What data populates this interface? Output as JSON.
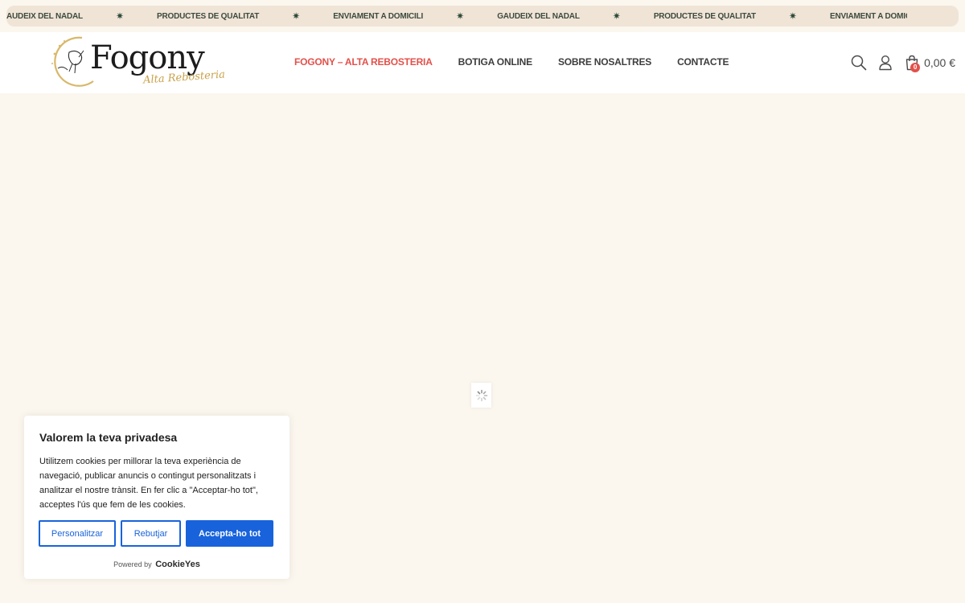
{
  "announcement": {
    "items": [
      "AUDEIX DEL NADAL",
      "PRODUCTES DE QUALITAT",
      "ENVIAMENT A DOMICILI",
      "GAUDEIX DEL NADAL",
      "PRODUCTES DE QUALITAT",
      "ENVIAMENT A DOMICILI"
    ],
    "separator": "✷"
  },
  "brand": {
    "name": "Fogony",
    "tagline": "Alta Rebosteria"
  },
  "nav": {
    "items": [
      {
        "label": "FOGONY – ALTA REBOSTERIA",
        "active": true
      },
      {
        "label": "BOTIGA ONLINE",
        "active": false
      },
      {
        "label": "SOBRE NOSALTRES",
        "active": false
      },
      {
        "label": "CONTACTE",
        "active": false
      }
    ]
  },
  "tools": {
    "search_icon": "search-icon",
    "account_icon": "user-icon",
    "cart_icon": "shopping-bag-icon",
    "cart_count": "0",
    "cart_total": "0,00 €"
  },
  "loader": {
    "icon": "spinner-icon"
  },
  "cookie": {
    "title": "Valorem la teva privadesa",
    "text": "Utilitzem cookies per millorar la teva experiència de navegació, publicar anuncis o contingut personalitzats i analitzar el nostre trànsit. En fer clic a \"Acceptar-ho tot\", acceptes l'ús que fem de les cookies.",
    "customize_label": "Personalitzar",
    "reject_label": "Rebutjar",
    "accept_label": "Accepta-ho tot",
    "powered_by": "Powered by",
    "brand": "CookieYes"
  },
  "colors": {
    "accent": "#e2504a",
    "marquee_bg": "#f0e4d7",
    "page_bg": "#fbf6ee",
    "cookie_button": "#1863dc",
    "logo_gold": "#c9a24a"
  }
}
